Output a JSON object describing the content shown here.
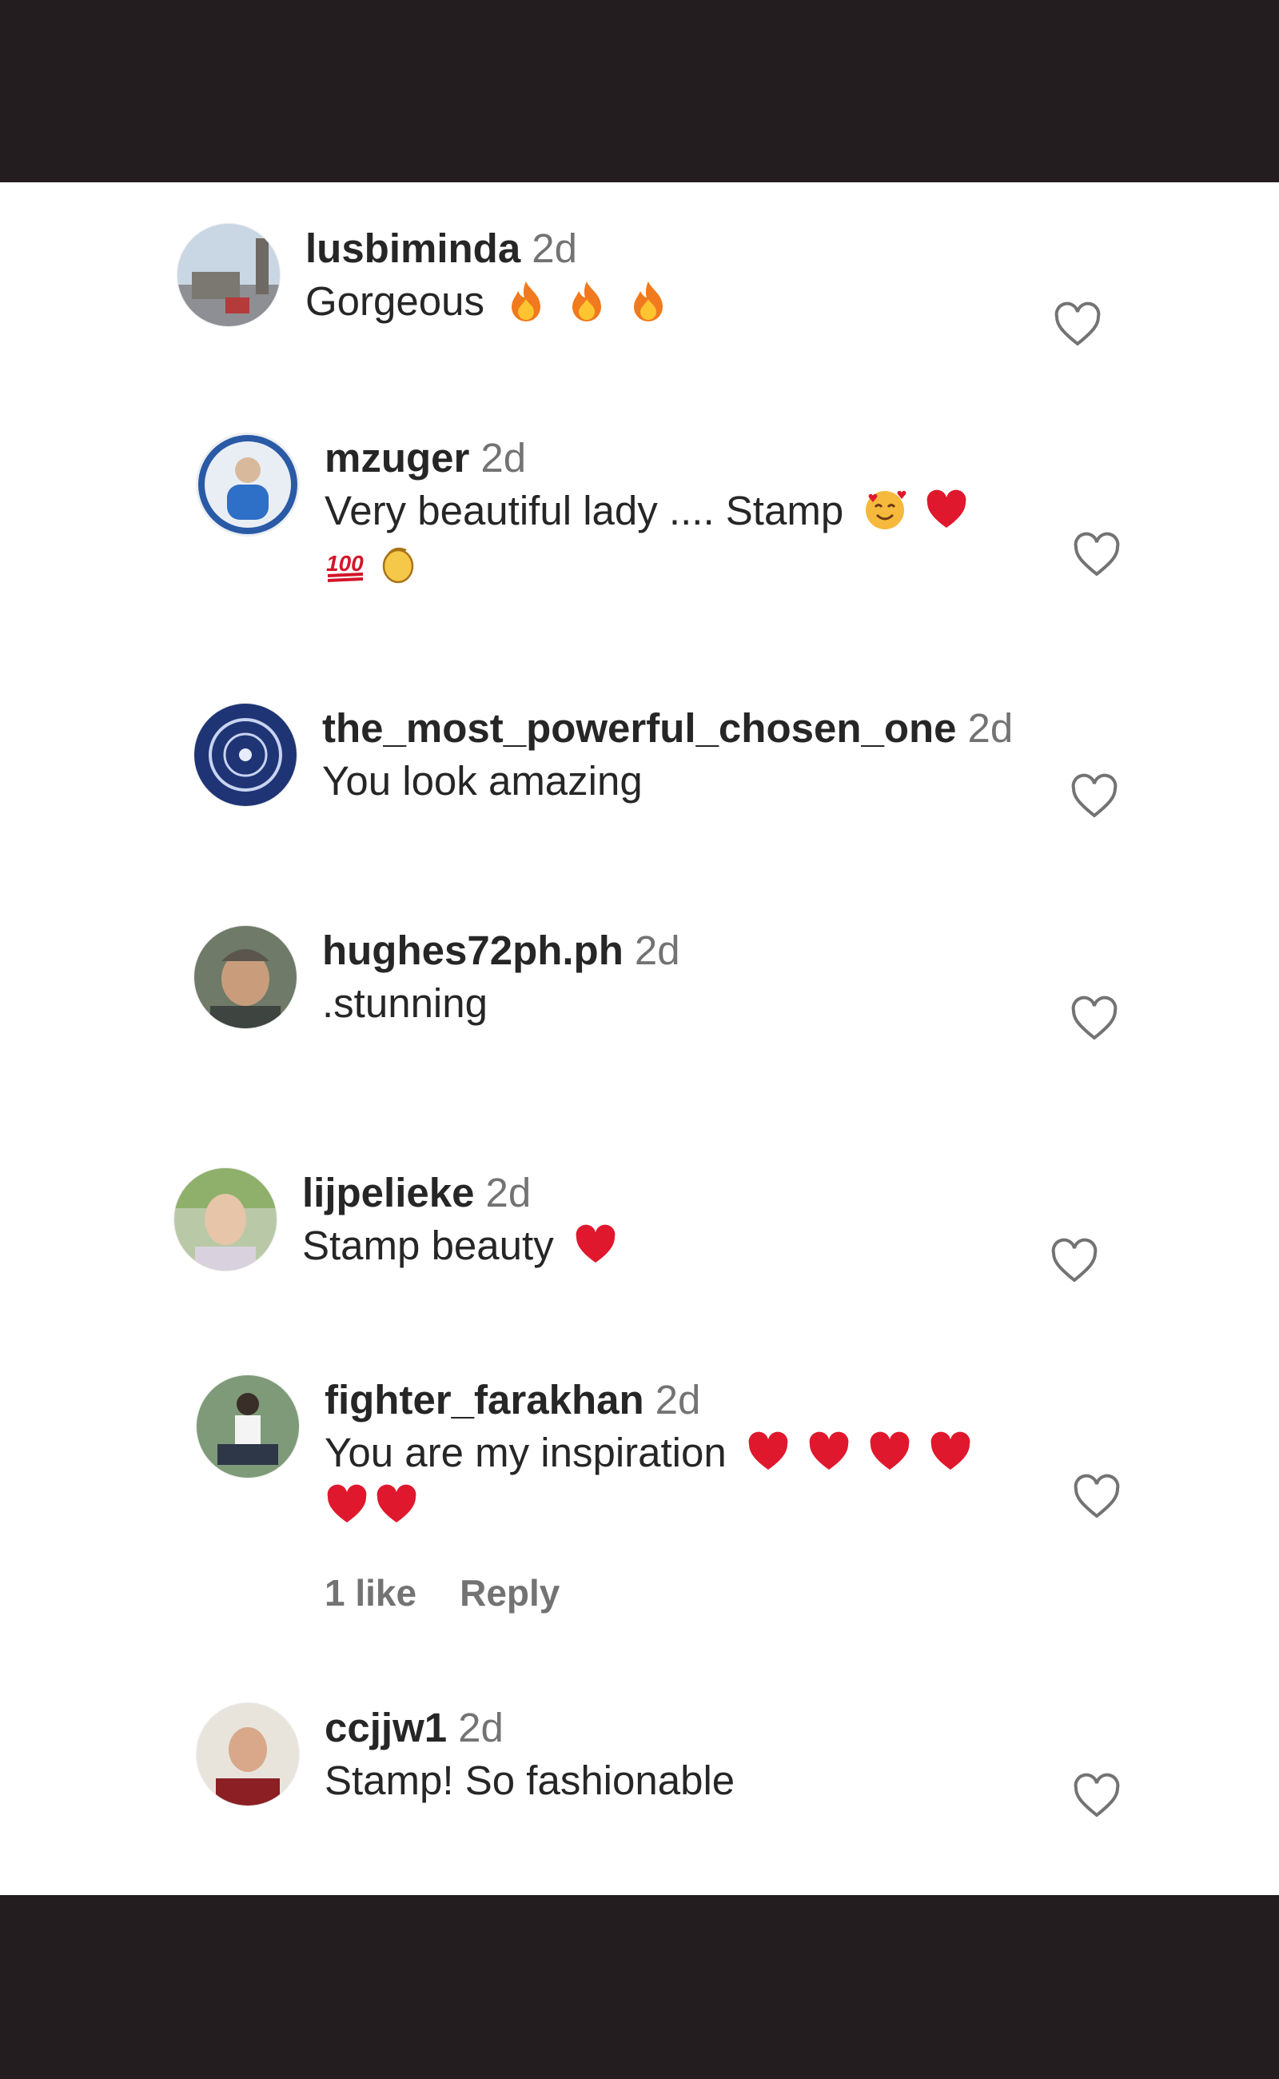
{
  "comments": [
    {
      "username": "lusbiminda",
      "time": "2d",
      "text": "Gorgeous",
      "emoji": [
        "fire-emoji",
        "fire-emoji",
        "fire-emoji"
      ],
      "avatar": "avatar-clock-tower"
    },
    {
      "username": "mzuger",
      "time": "2d",
      "text": "Very beautiful lady .... Stamp",
      "emoji": [
        "smiling-face-with-hearts-emoji",
        "red-heart-emoji"
      ],
      "emoji_line2": [
        "hundred-points-emoji",
        "clapping-hands-emoji"
      ],
      "avatar": "avatar-person-blue"
    },
    {
      "username": "the_most_powerful_chosen_one",
      "time": "2d",
      "text": "You look amazing",
      "avatar": "avatar-blue-emblem"
    },
    {
      "username": "hughes72ph.ph",
      "time": "2d",
      "text": ".stunning",
      "avatar": "avatar-man-outdoors"
    },
    {
      "username": "lijpelieke",
      "time": "2d",
      "text": "Stamp beauty",
      "emoji": [
        "red-heart-emoji"
      ],
      "avatar": "avatar-woman-green"
    },
    {
      "username": "fighter_farakhan",
      "time": "2d",
      "text": "You are my inspiration",
      "emoji": [
        "red-heart-emoji",
        "red-heart-emoji",
        "red-heart-emoji",
        "red-heart-emoji"
      ],
      "emoji_line2": [
        "red-heart-emoji",
        "red-heart-emoji"
      ],
      "likes_label": "1 like",
      "reply_label": "Reply",
      "avatar": "avatar-fighter-pose"
    },
    {
      "username": "ccjjw1",
      "time": "2d",
      "text": "Stamp! So fashionable",
      "avatar": "avatar-person-red"
    }
  ],
  "colors": {
    "username": "#262626",
    "secondary": "#737373",
    "band": "#231d1f",
    "heart": "#e0182d"
  }
}
